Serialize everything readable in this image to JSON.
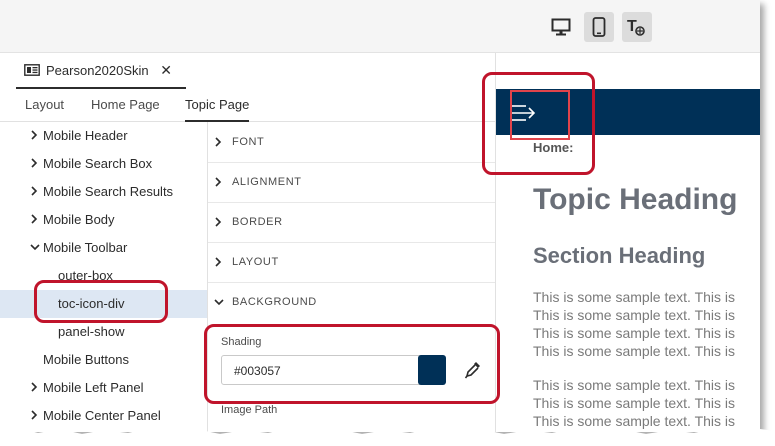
{
  "device_toolbar": {
    "buttons": [
      {
        "name": "desktop",
        "icon": "desktop-monitor-icon",
        "active": false
      },
      {
        "name": "mobile",
        "icon": "mobile-phone-icon",
        "active": true
      },
      {
        "name": "tablet",
        "icon": "text-resize-icon",
        "active": false
      }
    ]
  },
  "file_tab": {
    "name": "Pearson2020Skin",
    "close_label": "✕",
    "icon": "skin-file-icon"
  },
  "nav_tabs": [
    {
      "label": "Layout"
    },
    {
      "label": "Home Page"
    },
    {
      "label": "Topic Page",
      "active": true
    }
  ],
  "tree": {
    "items": [
      {
        "label": "Mobile Header",
        "expandable": true,
        "expanded": false
      },
      {
        "label": "Mobile Search Box",
        "expandable": true,
        "expanded": false
      },
      {
        "label": "Mobile Search Results",
        "expandable": true,
        "expanded": false
      },
      {
        "label": "Mobile Body",
        "expandable": true,
        "expanded": false
      },
      {
        "label": "Mobile Toolbar",
        "expandable": true,
        "expanded": true
      },
      {
        "label": "outer-box",
        "child": true
      },
      {
        "label": "toc-icon-div",
        "child": true,
        "selected": true
      },
      {
        "label": "panel-show",
        "child": true
      },
      {
        "label": "Mobile Buttons",
        "expandable": false
      },
      {
        "label": "Mobile Left Panel",
        "expandable": true,
        "expanded": false
      },
      {
        "label": "Mobile Center Panel",
        "expandable": true,
        "expanded": false
      }
    ]
  },
  "properties": {
    "sections": [
      {
        "label": "FONT",
        "expanded": false
      },
      {
        "label": "ALIGNMENT",
        "expanded": false
      },
      {
        "label": "BORDER",
        "expanded": false
      },
      {
        "label": "LAYOUT",
        "expanded": false
      },
      {
        "label": "BACKGROUND",
        "expanded": true
      }
    ],
    "shading": {
      "label": "Shading",
      "value": "#003057",
      "swatch_color": "#003057"
    },
    "image_path": {
      "label": "Image Path"
    }
  },
  "preview": {
    "toolbar_color": "#003057",
    "home_label": "Home:",
    "topic_heading": "Topic Heading",
    "section_heading": "Section Heading",
    "sample_lines": [
      "This is some sample text. This is",
      "This is some sample text. This is",
      "This is some sample text. This is",
      "This is some sample text. This is",
      "This is some sample text. This is",
      "This is some sample text. This is",
      "This is some sample text. This is"
    ]
  },
  "colors": {
    "accent_red": "#c0142b",
    "selection": "#dde7f3",
    "brand_navy": "#003057"
  }
}
